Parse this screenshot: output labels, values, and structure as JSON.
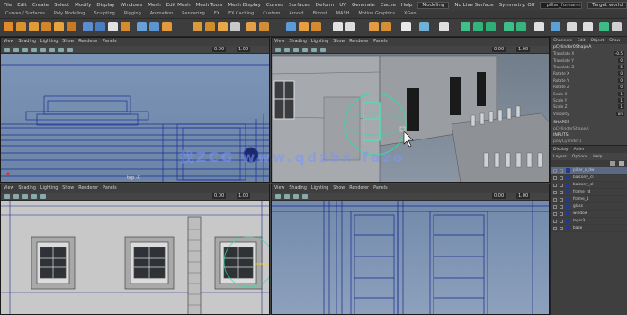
{
  "menubar": {
    "items": [
      "File",
      "Edit",
      "Create",
      "Select",
      "Modify",
      "Display",
      "Windows",
      "Mesh",
      "Edit Mesh",
      "Mesh Tools",
      "Mesh Display",
      "Curves",
      "Surfaces",
      "Deform",
      "UV",
      "Generate",
      "Cache",
      "Help"
    ],
    "mode": "Modeling",
    "no_live": "No Live Surface",
    "symmetry": "Symmetry: Off",
    "field": "pillar_forearm2",
    "target": "Target world"
  },
  "shelf_tabs": [
    "Curves / Surfaces",
    "Poly Modeling",
    "Sculpting",
    "Rigging",
    "Animation",
    "Rendering",
    "FX",
    "FX Caching",
    "Custom",
    "Arnold",
    "Bifrost",
    "MASH",
    "Motion Graphics",
    "XGen"
  ],
  "viewports": {
    "top_left": {
      "menu": [
        "View",
        "Shading",
        "Lighting",
        "Show",
        "Renderer",
        "Panels"
      ],
      "label": "top -X",
      "coords": "0.00",
      "gamma": "1.00"
    },
    "top_right": {
      "menu": [
        "View",
        "Shading",
        "Lighting",
        "Show",
        "Renderer",
        "Panels"
      ],
      "coords": "0.00",
      "gamma": "1.00"
    },
    "bottom_left": {
      "menu": [
        "View",
        "Shading",
        "Lighting",
        "Show",
        "Renderer",
        "Panels"
      ],
      "coords": "0.00",
      "gamma": "1.00"
    },
    "bottom_right": {
      "menu": [
        "View",
        "Shading",
        "Lighting",
        "Show",
        "Renderer",
        "Panels"
      ],
      "coords": "0.00",
      "gamma": "1.00"
    }
  },
  "watermark": "找ZCG  www.qdzbx-fazo",
  "right_panel": {
    "tabs": [
      "Channels",
      "Edit",
      "Object",
      "Show"
    ],
    "object_name": "pCylinder0ShapeA",
    "attrs": [
      {
        "name": "Translate X",
        "value": "-0.5"
      },
      {
        "name": "Translate Y",
        "value": "0"
      },
      {
        "name": "Translate Z",
        "value": "5"
      },
      {
        "name": "Rotate X",
        "value": "0"
      },
      {
        "name": "Rotate Y",
        "value": "0"
      },
      {
        "name": "Rotate Z",
        "value": "0"
      },
      {
        "name": "Scale X",
        "value": "1"
      },
      {
        "name": "Scale Y",
        "value": "1"
      },
      {
        "name": "Scale Z",
        "value": "1"
      },
      {
        "name": "Visibility",
        "value": "on"
      }
    ],
    "shapes_header": "SHAPES",
    "shape_name": "pCylinderShapeA",
    "inputs_header": "INPUTS",
    "input_name": "polyCylinder1",
    "layer_tabs": [
      "Display",
      "Anim"
    ],
    "layer_menu": [
      "Layers",
      "Options",
      "Help"
    ],
    "layers": [
      {
        "name": "pillar_s_dw",
        "selected": true
      },
      {
        "name": "balcony_cl"
      },
      {
        "name": "balcony_sl"
      },
      {
        "name": "frame_rd"
      },
      {
        "name": "frame_1"
      },
      {
        "name": "glass"
      },
      {
        "name": "window"
      },
      {
        "name": "layer1"
      },
      {
        "name": "base"
      }
    ]
  },
  "colors": {
    "accent": "#5a6a86",
    "grid": "#1c2f9a",
    "selection": "#2fe0a0"
  }
}
